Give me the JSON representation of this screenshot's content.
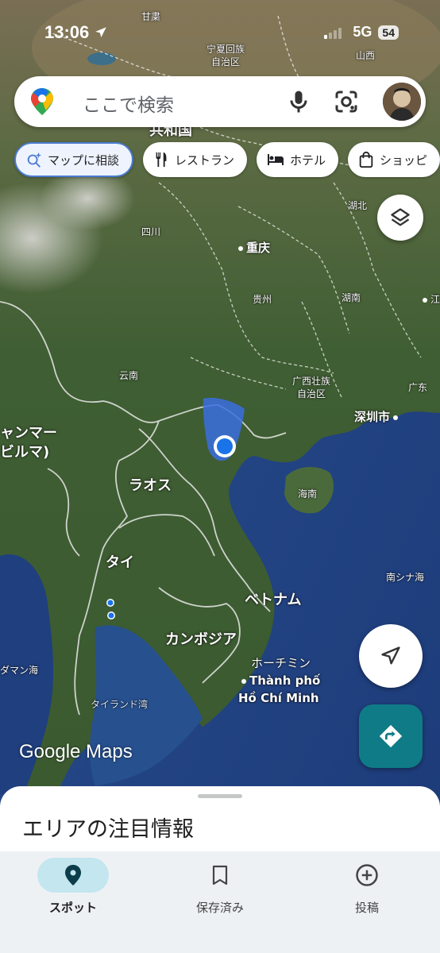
{
  "status_bar": {
    "time": "13:06",
    "network": "5G",
    "battery": "54"
  },
  "search": {
    "placeholder": "ここで検索"
  },
  "chips": [
    {
      "label": "マップに相談",
      "icon": "sparkle-search-icon"
    },
    {
      "label": "レストラン",
      "icon": "fork-knife-icon"
    },
    {
      "label": "ホテル",
      "icon": "bed-icon"
    },
    {
      "label": "ショッピ",
      "icon": "shopping-bag-icon"
    }
  ],
  "map_labels": {
    "gansu": "甘粛",
    "ningxia": "宁夏回族\n自治区",
    "shanxi": "山西",
    "republic": "共和国",
    "hubei": "湖北",
    "sichuan": "四川",
    "chongqing": "重庆",
    "guizhou": "贵州",
    "hunan": "湖南",
    "jiangxi": "江西",
    "yunnan": "云南",
    "guangxi": "广西壮族\n自治区",
    "guangdong": "广东",
    "shenzhen": "深圳市",
    "myanmar": "ャンマー\nビルマ)",
    "laos": "ラオス",
    "hainan": "海南",
    "thailand": "タイ",
    "vietnam": "ベトナム",
    "south_china_sea": "南シナ海",
    "cambodia": "カンボジア",
    "andaman": "ダマン海",
    "hochiminh_jp": "ホーチミン",
    "hochiminh_vn": "Thành phố\nHồ Chí Minh",
    "gulf_thailand": "タイランド湾"
  },
  "watermark": "Google Maps",
  "sheet": {
    "title": "エリアの注目情報"
  },
  "nav": [
    {
      "label": "スポット",
      "icon": "location-pin-icon",
      "active": true
    },
    {
      "label": "保存済み",
      "icon": "bookmark-icon",
      "active": false
    },
    {
      "label": "投稿",
      "icon": "add-circle-icon",
      "active": false
    }
  ],
  "colors": {
    "accent_teal": "#0f7b86",
    "location_blue": "#1a73e8",
    "nav_active_pill": "#c3e6ef"
  }
}
